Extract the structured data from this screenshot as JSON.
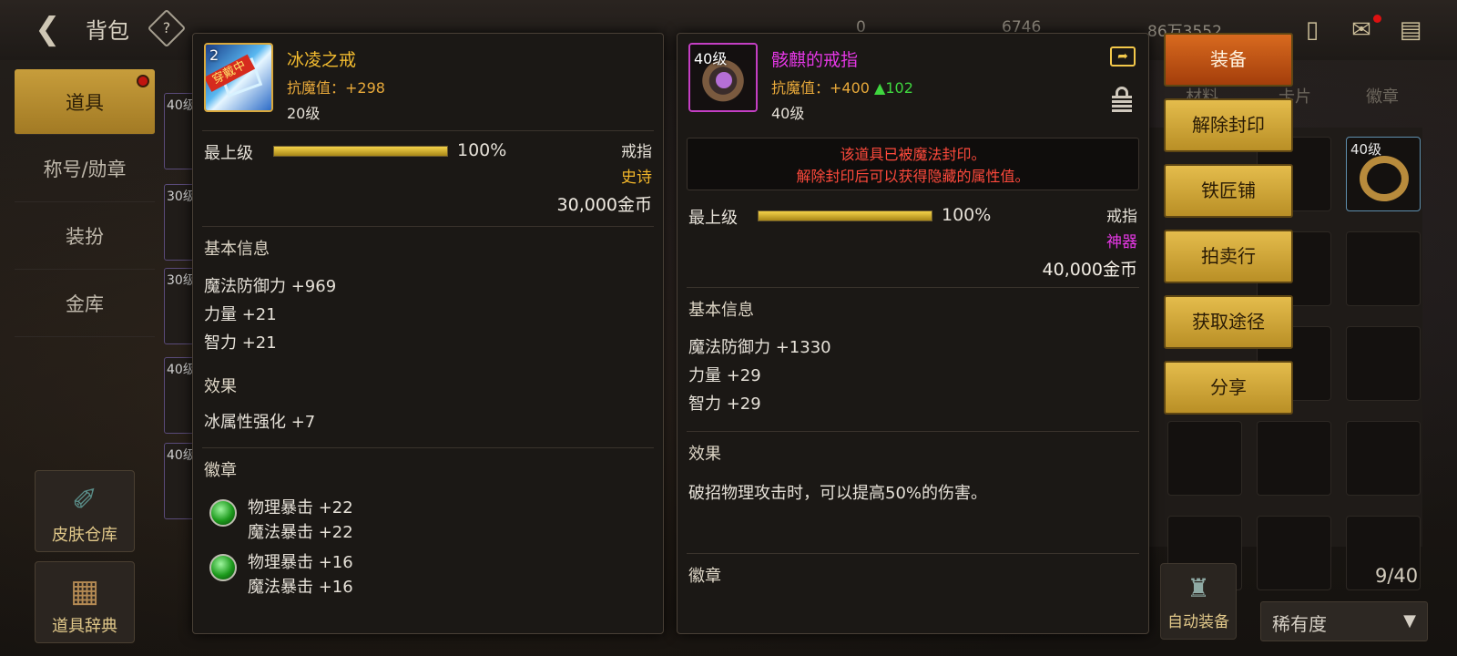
{
  "header": {
    "title": "背包",
    "currencies": [
      "0",
      "6746",
      "86万3552"
    ]
  },
  "left_nav": [
    {
      "label": "道具",
      "active": true
    },
    {
      "label": "称号/勋章",
      "active": false
    },
    {
      "label": "装扮",
      "active": false
    },
    {
      "label": "金库",
      "active": false
    }
  ],
  "side_buttons": {
    "skin_storage": "皮肤仓库",
    "item_dictionary": "道具辞典"
  },
  "left_slots": [
    "40级",
    "30级",
    "30级",
    "40级",
    "40级"
  ],
  "inventory": {
    "tabs": [
      "材料",
      "卡片",
      "徽章"
    ],
    "slot_level": "40级",
    "auto_equip": "自动装备",
    "capacity": "9/40",
    "sort": "稀有度"
  },
  "equipped_item": {
    "name": "冰凌之戒",
    "resist_label": "抗魔值：+298",
    "level": "20级",
    "equipped_badge": "穿戴中",
    "icon_level": "2",
    "grade_label": "最上级",
    "grade_percent": 100,
    "grade_text": "100%",
    "type": "戒指",
    "rarity": "史诗",
    "price": "30,000金币",
    "basic_title": "基本信息",
    "basic": [
      "魔法防御力 +969",
      "力量 +21",
      "智力 +21"
    ],
    "effect_title": "效果",
    "effect": "冰属性强化 +7",
    "emblem_title": "徽章",
    "emblems": [
      [
        "物理暴击 +22",
        "魔法暴击 +22"
      ],
      [
        "物理暴击 +16",
        "魔法暴击 +16"
      ]
    ]
  },
  "compare_item": {
    "name": "骸麒的戒指",
    "resist_label": "抗魔值：+400",
    "resist_delta": "▲102",
    "level": "40级",
    "icon_level": "40级",
    "seal_line1": "该道具已被魔法封印。",
    "seal_line2": "解除封印后可以获得隐藏的属性值。",
    "grade_label": "最上级",
    "grade_percent": 100,
    "grade_text": "100%",
    "type": "戒指",
    "rarity": "神器",
    "price": "40,000金币",
    "basic_title": "基本信息",
    "basic": [
      "魔法防御力 +1330",
      "力量 +29",
      "智力 +29"
    ],
    "effect_title": "效果",
    "effect": "破招物理攻击时，可以提高50%的伤害。",
    "emblem_title": "徽章"
  },
  "actions": [
    "装备",
    "解除封印",
    "铁匠铺",
    "拍卖行",
    "获取途径",
    "分享"
  ],
  "colors": {
    "epic": "#f2b62a",
    "legendary": "#e537e5",
    "seal_warning": "#ff4a3c",
    "primary_button": "#c2561a",
    "button_gold": "#d6ae40"
  }
}
